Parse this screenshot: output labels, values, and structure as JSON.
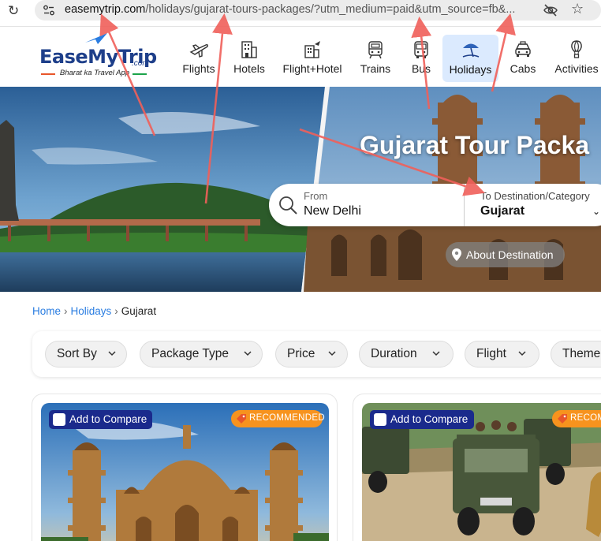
{
  "browser": {
    "url_domain": "easemytrip.com",
    "url_rest": "/holidays/gujarat-tours-packages/?utm_medium=paid&utm_source=fb&...",
    "reload_icon": "reload-icon",
    "site_info_icon": "site-info-icon",
    "eye_off_icon": "eye-off-icon",
    "star_icon": "bookmark-star-icon"
  },
  "logo": {
    "name_ease": "EaseMy",
    "name_trip": "Trip",
    "suffix": ".com",
    "tagline": "Bharat ka Travel App"
  },
  "nav": [
    {
      "label": "Flights",
      "icon": "airplane-icon",
      "active": false
    },
    {
      "label": "Hotels",
      "icon": "hotel-building-icon",
      "active": false
    },
    {
      "label": "Flight+Hotel",
      "icon": "flight-hotel-icon",
      "active": false
    },
    {
      "label": "Trains",
      "icon": "train-icon",
      "active": false
    },
    {
      "label": "Bus",
      "icon": "bus-icon",
      "active": false
    },
    {
      "label": "Holidays",
      "icon": "beach-umbrella-icon",
      "active": true
    },
    {
      "label": "Cabs",
      "icon": "car-icon",
      "active": false
    },
    {
      "label": "Activities",
      "icon": "hot-air-balloon-icon",
      "active": false
    }
  ],
  "hero": {
    "title": "Gujarat Tour Packa",
    "search": {
      "from_label": "From",
      "from_value": "New Delhi",
      "to_label": "To Destination/Category",
      "to_value": "Gujarat"
    },
    "about_destination": "About Destination"
  },
  "breadcrumb": {
    "home": "Home",
    "holidays": "Holidays",
    "current": "Gujarat"
  },
  "filters": [
    "Sort By",
    "Package Type",
    "Price",
    "Duration",
    "Flight",
    "Theme"
  ],
  "cards": [
    {
      "compare_label": "Add to Compare",
      "badge": "RECOMMENDED",
      "image": "mahabat-maqbara-palace-photo"
    },
    {
      "compare_label": "Add to Compare",
      "badge": "RECOM",
      "image": "gir-safari-jeeps-photo"
    }
  ],
  "colors": {
    "brand_blue": "#1e3f8a",
    "link_blue": "#2a7de1",
    "active_nav_bg": "#dbeafe",
    "compare_bg": "#1a2a8c",
    "badge_orange": "#f7931e",
    "annotation_red": "#f0605a"
  }
}
